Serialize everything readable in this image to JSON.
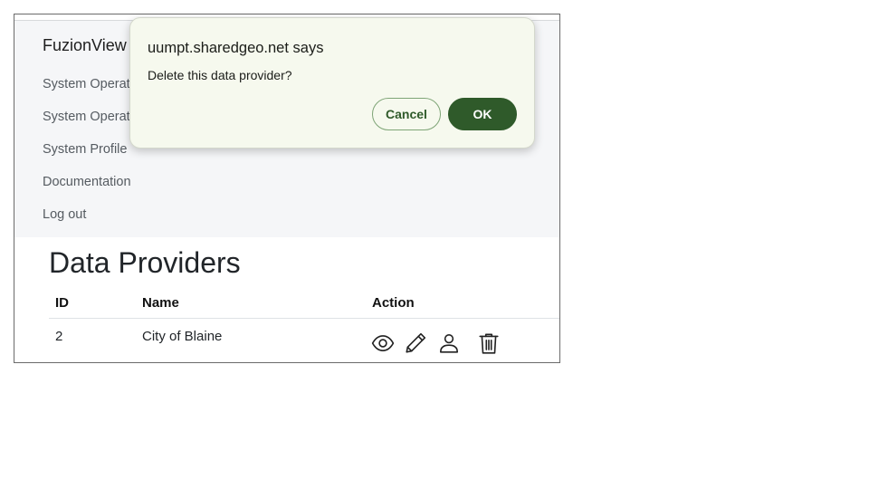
{
  "navbar": {
    "brand": "FuzionView A",
    "links": [
      {
        "label": "System Operat",
        "icon": null
      },
      {
        "label": "System Operat",
        "icon": null
      },
      {
        "label": "System Profile",
        "icon": null
      },
      {
        "label": "Documentation",
        "icon": null
      },
      {
        "label": "Log out",
        "icon": null
      }
    ]
  },
  "main": {
    "title": "Data Providers",
    "table": {
      "columns": [
        "ID",
        "Name",
        "Action"
      ],
      "rows": [
        {
          "id": "2",
          "name": "City of Blaine",
          "actions": [
            "eye-icon",
            "pencil-icon",
            "user-icon",
            "trash-icon"
          ]
        }
      ]
    }
  },
  "dialog": {
    "title": "uumpt.sharedgeo.net says",
    "message": "Delete this data provider?",
    "cancel_label": "Cancel",
    "ok_label": "OK"
  },
  "colors": {
    "dialog_bg": "#f6f9ee",
    "accent": "#2f5a2a",
    "navbar_bg": "#f5f6f8"
  }
}
